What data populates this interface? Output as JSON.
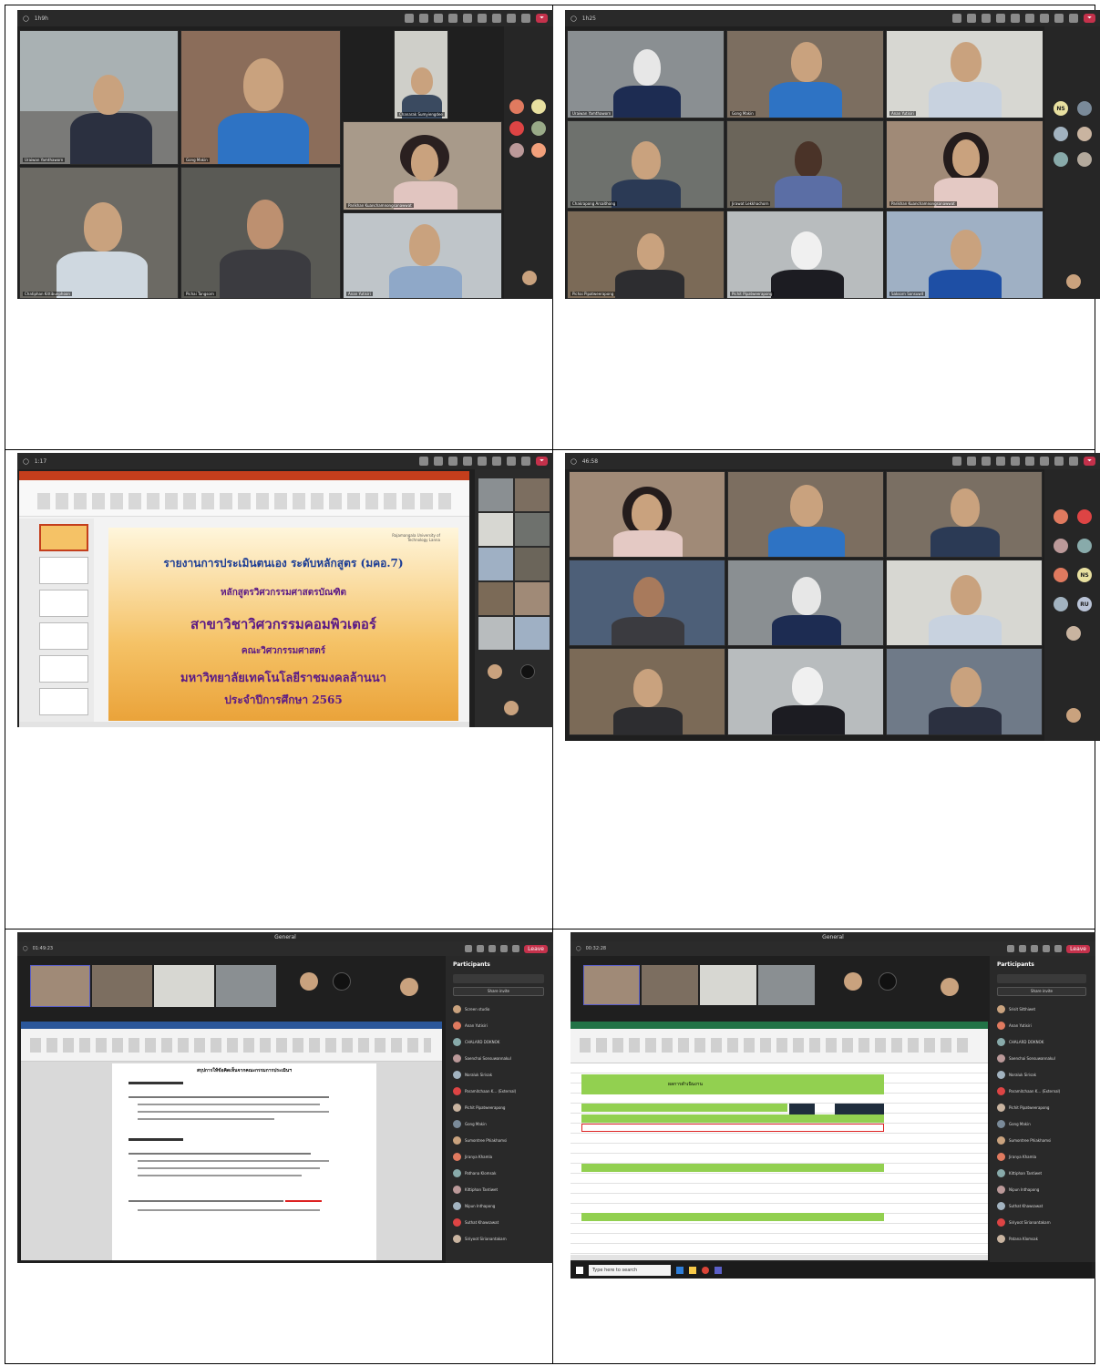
{
  "screenshots": [
    {
      "time": "1h9h",
      "names": [
        "Uraiwan Yamthaworn",
        "Gong Makin",
        "Chanarak Sumyiengdee",
        "Parikhan Kuanchamnongsanawwat",
        "Anan Yutisiri",
        "Chatiphan Kittibunphoon",
        "Pichai Tangsorn",
        "",
        ""
      ]
    },
    {
      "time": "1h25",
      "names": [
        "Uraiwan Yamthaworn",
        "Gong Makin",
        "Anan Yutisiri",
        "Chakrapong Arsaithong",
        "Jirawat Lekkhachorn",
        "Parikhan Kuanchamnongsanawwat",
        "Pichai Pipatweerapong",
        "Pichit Pipatweerapong",
        "Saksorn Sonsuwit"
      ],
      "avatar_initials": [
        "NS"
      ]
    },
    {
      "time": "1:17",
      "slide_lines": [
        "รายงานการประเมินตนเอง ระดับหลักสูตร (มคอ.7)",
        "หลักสูตรวิศวกรรมศาสตรบัณฑิต",
        "สาขาวิชาวิศวกรรมคอมพิวเตอร์",
        "คณะวิศวกรรมศาสตร์",
        "มหาวิทยาลัยเทคโนโลยีราชมงคลล้านนา",
        "ประจำปีการศึกษา 2565"
      ],
      "slide_logo": "Rajamangala University of Technology Lanna"
    },
    {
      "time": "46:58",
      "avatar_initials": [
        "NS",
        "RU"
      ]
    },
    {
      "time": "01:49:23",
      "title": "General",
      "leave": "Leave",
      "participants_title": "Participants",
      "share_invite": "Share invite",
      "participants": [
        "Screen studio",
        "Anan Yutisiri",
        "CHALARD DOKNOK",
        "Saenchai Sonsuwannakul",
        "Noraluk Sirisak",
        "Paramitchaan K... (External)",
        "Pichit Pipatweerapong",
        "Gong Makin",
        "Sumontree Phiakhamsi",
        "Jiranya Khamla",
        "Pathana Klomsak",
        "Kittiphan Tantiwet",
        "Nipun Inthapong",
        "Suthat Khawsawat",
        "Siriyoot Sirianantakarn"
      ],
      "doc_title": "สรุปการให้ข้อคิดเห็นจากคณะกรรมการประเมินฯ"
    },
    {
      "time": "00:32:28",
      "title": "General",
      "leave": "Leave",
      "participants_title": "Participants",
      "share_invite": "Share invite",
      "participants": [
        "Srisit Sitthiwet",
        "Anan Yutisiri",
        "CHALARD DOKNOK",
        "Saenchai Sonsuwannakul",
        "Noraluk Sirisak",
        "Paramitchaan K... (External)",
        "Pichit Pipatweerapong",
        "Gong Makin",
        "Sumontree Phiakhamsi",
        "Jiranya Khamla",
        "Kittiphan Tantiwet",
        "Nipun Inthapong",
        "Suthat Khawsawat",
        "Siriyoot Sirianantakarn",
        "Patana Klomsak"
      ],
      "taskbar_search": "Type here to search",
      "sheet_header": "ผลการดำเนินงาน"
    }
  ],
  "colors": {
    "teams_dark": "#1f1f1f",
    "leave_red": "#c4314b",
    "slide_title_blue": "#1c3d95",
    "slide_title_purple": "#5b1a86"
  }
}
